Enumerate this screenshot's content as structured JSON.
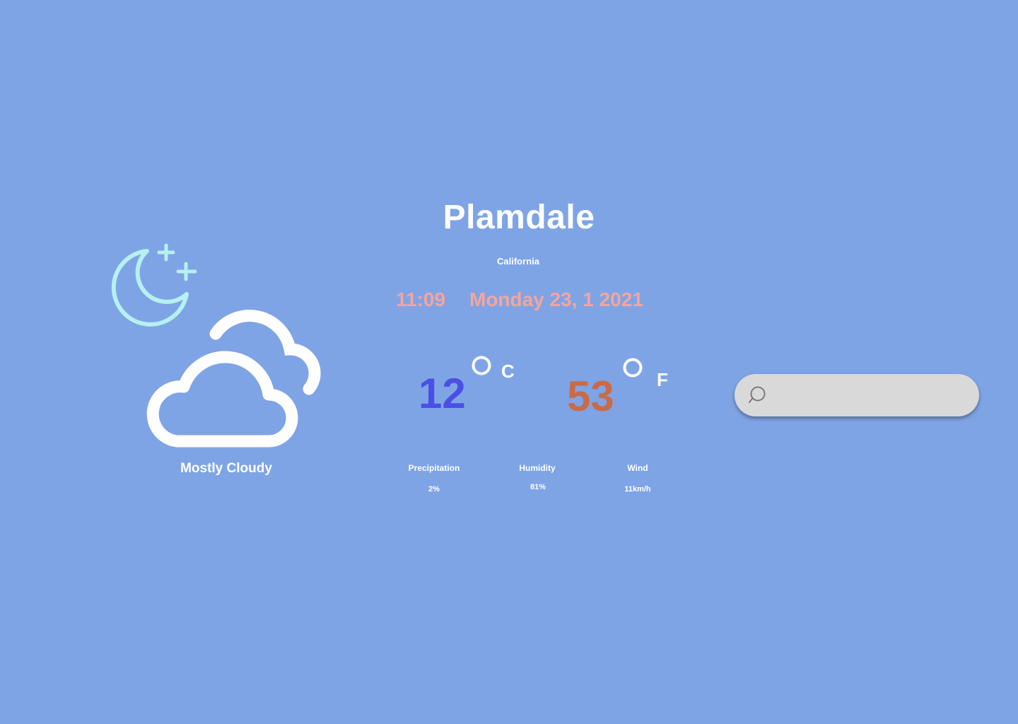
{
  "weather": {
    "condition": "Mostly Cloudy",
    "icons": [
      "moon-stars-icon",
      "cloud-icon"
    ]
  },
  "location": {
    "city": "Plamdale",
    "region": "California"
  },
  "datetime": {
    "time": "11:09",
    "date": "Monday 23, 1 2021"
  },
  "temperature": {
    "celsius": "12",
    "celsius_unit": "C",
    "fahrenheit": "53",
    "fahrenheit_unit": "F"
  },
  "stats": {
    "precipitation_label": "Precipitation",
    "precipitation_value": "2%",
    "humidity_label": "Humidity",
    "humidity_value": "81%",
    "wind_label": "Wind",
    "wind_value": "11km/h"
  },
  "search": {
    "placeholder": ""
  },
  "colors": {
    "background": "#7fa4e5",
    "moon": "#b6f0f1",
    "accent_time": "#f4a59e",
    "celsius": "#4b4fe6",
    "fahrenheit": "#c86b48",
    "search_bg": "#d9d9d9"
  }
}
